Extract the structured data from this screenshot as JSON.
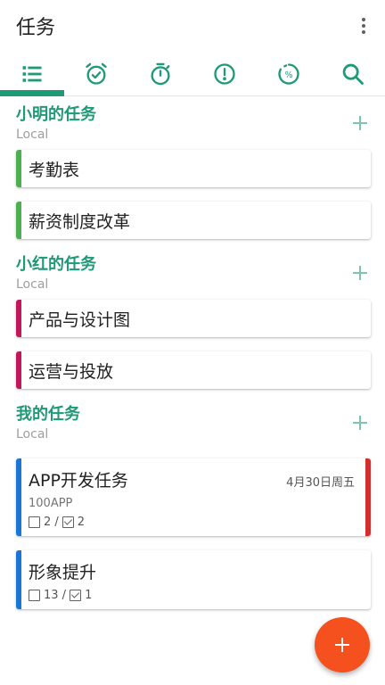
{
  "app": {
    "title": "任务"
  },
  "colors": {
    "accent": "#1f9a77",
    "green": "#4caf50",
    "pink": "#c2185b",
    "blue": "#1976d2",
    "red": "#d32f2f",
    "fab": "#f4511e"
  },
  "tabs": [
    {
      "icon": "list-icon",
      "active": true
    },
    {
      "icon": "alarm-icon",
      "active": false
    },
    {
      "icon": "timer-icon",
      "active": false
    },
    {
      "icon": "priority-icon",
      "active": false
    },
    {
      "icon": "progress-icon",
      "active": false
    },
    {
      "icon": "search-icon",
      "active": false
    }
  ],
  "sections": [
    {
      "title": "小明的任务",
      "account": "Local",
      "tasks": [
        {
          "title": "考勤表"
        },
        {
          "title": "薪资制度改革"
        }
      ]
    },
    {
      "title": "小红的任务",
      "account": "Local",
      "tasks": [
        {
          "title": "产品与设计图"
        },
        {
          "title": "运营与投放"
        }
      ]
    },
    {
      "title": "我的任务",
      "account": "Local",
      "tasks": [
        {
          "title": "APP开发任务",
          "date": "4月30日周五",
          "subtitle": "100APP",
          "open_count": "2 /",
          "done_count": "2"
        },
        {
          "title": "形象提升",
          "open_count": "13 /",
          "done_count": "1"
        }
      ]
    }
  ],
  "fab": {
    "icon": "plus-icon"
  }
}
